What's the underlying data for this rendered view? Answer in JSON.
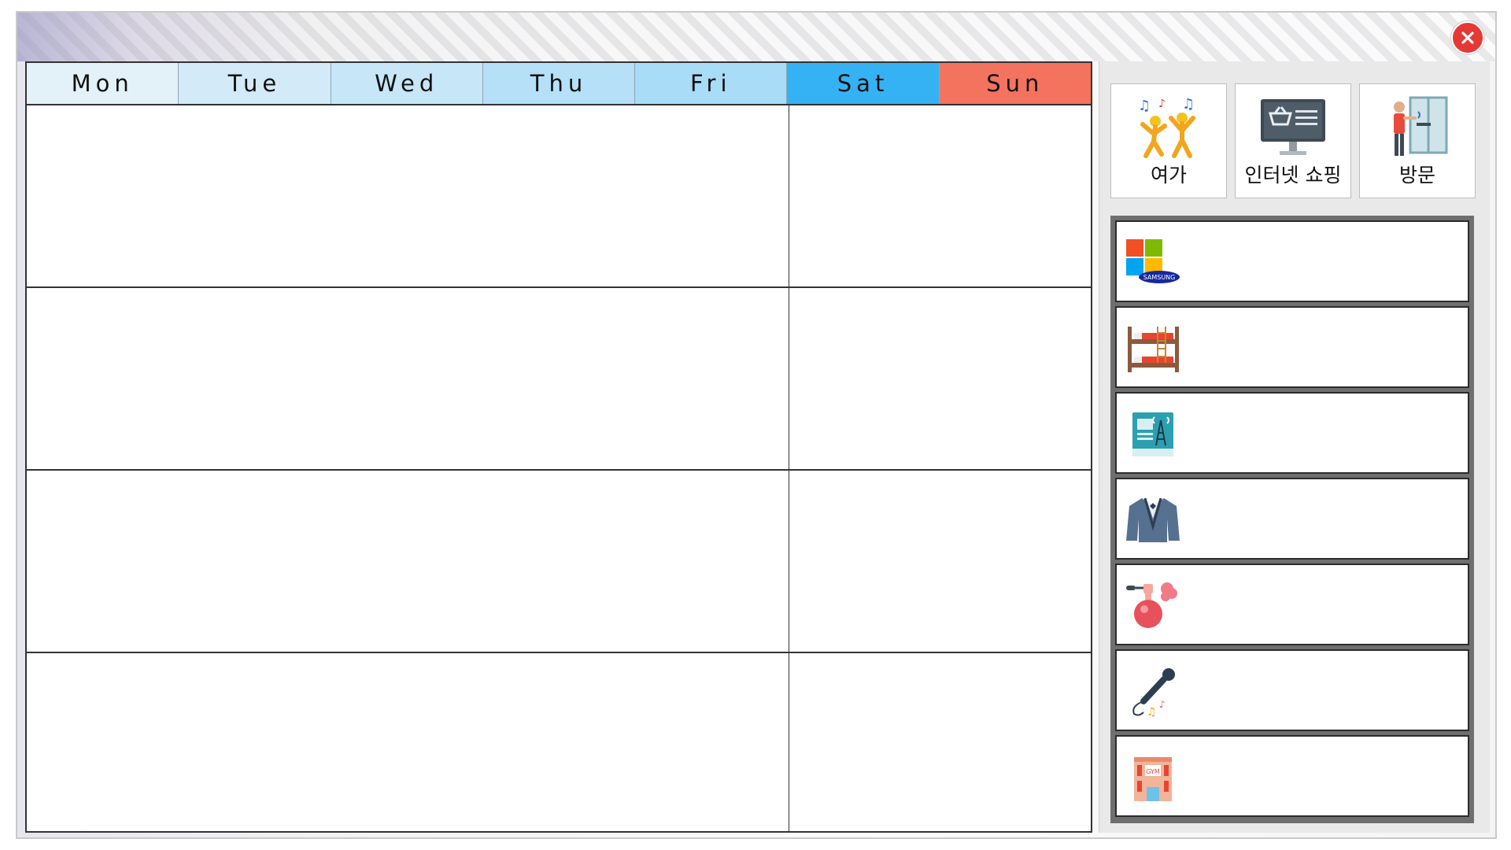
{
  "calendar": {
    "days": [
      {
        "label": "Mon",
        "bg": "#e3f1f8"
      },
      {
        "label": "Tue",
        "bg": "#d3ebf8"
      },
      {
        "label": "Wed",
        "bg": "#c7e7f8"
      },
      {
        "label": "Thu",
        "bg": "#b5e0f7"
      },
      {
        "label": "Fri",
        "bg": "#a8dcf7"
      },
      {
        "label": "Sat",
        "bg": "#35b2f4"
      },
      {
        "label": "Sun",
        "bg": "#f4735e"
      }
    ],
    "week_rows": 4
  },
  "panel": {
    "categories": [
      {
        "label": "여가",
        "icon": "dancing-people-icon"
      },
      {
        "label": "인터넷 쇼핑",
        "icon": "online-shopping-monitor-icon"
      },
      {
        "label": "방문",
        "icon": "person-visiting-door-icon"
      }
    ],
    "items": [
      {
        "icon": "samsung-windows-logo-icon",
        "logo_text": "SAMSUNG"
      },
      {
        "icon": "bunk-bed-icon"
      },
      {
        "icon": "broadcast-tower-book-icon"
      },
      {
        "icon": "suit-jacket-icon"
      },
      {
        "icon": "perfume-bottle-icon"
      },
      {
        "icon": "karaoke-microphone-icon"
      },
      {
        "icon": "gym-building-icon",
        "logo_text": "GYM"
      }
    ]
  },
  "colors": {
    "close": "#e53935",
    "saturday": "#35b2f4",
    "sunday": "#f4735e"
  }
}
